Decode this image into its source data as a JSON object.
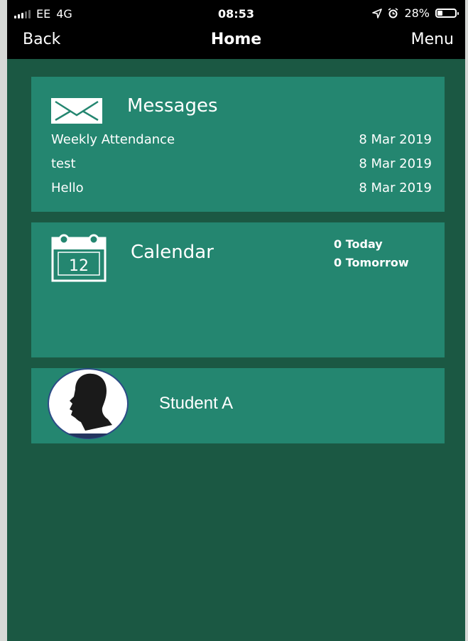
{
  "status_bar": {
    "carrier": "EE",
    "network": "4G",
    "time": "08:53",
    "battery": "28%",
    "battery_level": 0.28,
    "icons": [
      "signal-icon",
      "location-arrow-icon",
      "alarm-icon",
      "battery-icon"
    ]
  },
  "nav": {
    "back_label": "Back",
    "title": "Home",
    "menu_label": "Menu"
  },
  "messages": {
    "title": "Messages",
    "icon": "envelope-icon",
    "items": [
      {
        "subject": "Weekly Attendance",
        "date": "8 Mar 2019"
      },
      {
        "subject": "test",
        "date": "8 Mar 2019"
      },
      {
        "subject": "Hello",
        "date": "8 Mar 2019"
      }
    ]
  },
  "calendar": {
    "title": "Calendar",
    "icon": "calendar-icon",
    "icon_day": "12",
    "today": "0 Today",
    "tomorrow": "0 Tomorrow"
  },
  "student": {
    "name": "Student A",
    "icon": "avatar-silhouette-icon"
  },
  "colors": {
    "background": "#1b5843",
    "card": "#248670",
    "bars": "#000000",
    "text": "#ffffff"
  }
}
